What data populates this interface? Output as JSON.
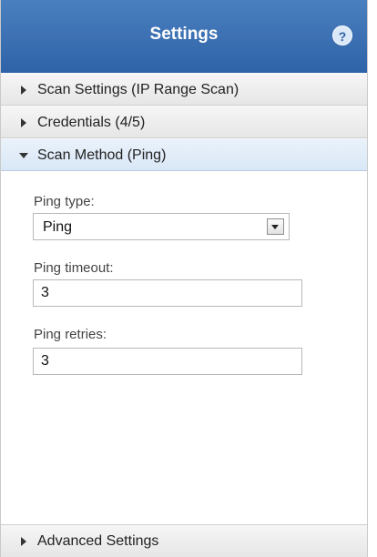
{
  "header": {
    "title": "Settings",
    "help_icon": "?"
  },
  "sections": [
    {
      "label": "Scan Settings (IP Range Scan)",
      "expanded": false
    },
    {
      "label": "Credentials (4/5)",
      "expanded": false
    },
    {
      "label": "Scan Method (Ping)",
      "expanded": true
    },
    {
      "label": "Advanced Settings",
      "expanded": false
    }
  ],
  "scan_method": {
    "ping_type": {
      "label": "Ping type:",
      "value": "Ping"
    },
    "ping_timeout": {
      "label": "Ping timeout:",
      "value": "3"
    },
    "ping_retries": {
      "label": "Ping retries:",
      "value": "3"
    }
  },
  "colors": {
    "header_bg": "#2f63a8",
    "active_section_bg": "#d9e7f6"
  }
}
